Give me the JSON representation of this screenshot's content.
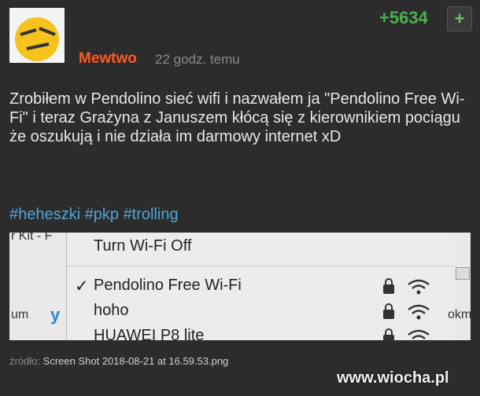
{
  "post": {
    "vote_count": "+5634",
    "vote_button_label": "+",
    "author": "Mewtwo",
    "timestamp": "22 godz. temu",
    "text": "Zrobiłem w Pendolino sieć wifi i nazwałem ja \"Pendolino Free Wi-Fi\" i teraz Grażyna z Januszem kłócą się z kierownikiem pociągu że oszukują i nie działa im darmowy internet xD",
    "tags": [
      "#heheszki",
      "#pkp",
      "#trolling"
    ]
  },
  "screenshot": {
    "menu_items": [
      {
        "label": "Turn Wi-Fi Off"
      },
      {
        "label": "Pendolino Free Wi-Fi",
        "checked": true
      },
      {
        "label": "hoho"
      },
      {
        "label": "HUAWEI P8 lite"
      }
    ],
    "left_fragment_top": "r Kit - F",
    "left_fragment_mid": "um",
    "right_fragment_mid": "okm"
  },
  "footer": {
    "source_label": "źródło:",
    "source_file": "Screen Shot 2018-08-21 at 16.59.53.png",
    "watermark": "www.wiocha.pl"
  }
}
